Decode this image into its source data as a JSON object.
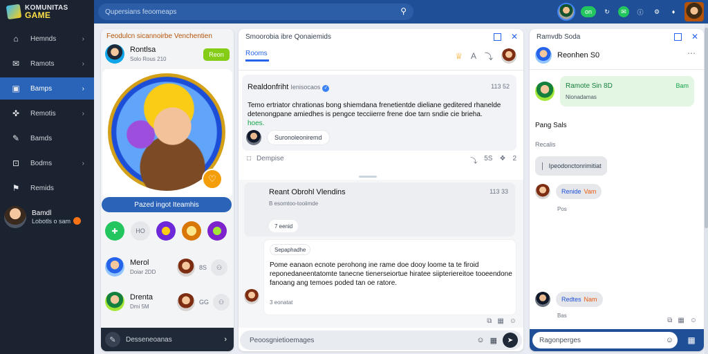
{
  "app": {
    "logo_line1": "KOMUNITAS",
    "logo_line2": "GAME"
  },
  "sidebar": {
    "items": [
      {
        "label": "Hemnds",
        "icon": "home-icon",
        "glyph": "⌂",
        "chevron": true
      },
      {
        "label": "Ramots",
        "icon": "chat-icon",
        "glyph": "✉",
        "chevron": true
      },
      {
        "label": "Bamps",
        "icon": "folder-icon",
        "glyph": "▣",
        "chevron": true,
        "active": true
      },
      {
        "label": "Remotis",
        "icon": "gamepad-icon",
        "glyph": "✜",
        "chevron": true
      },
      {
        "label": "Bamds",
        "icon": "pen-icon",
        "glyph": "✎",
        "chevron": false
      },
      {
        "label": "Bodms",
        "icon": "lock-icon",
        "glyph": "⊡",
        "chevron": true
      },
      {
        "label": "Remids",
        "icon": "flag-icon",
        "glyph": "⚑",
        "chevron": false
      }
    ],
    "user": {
      "name": "Bamdl",
      "status": "Lobotls o sam"
    }
  },
  "topbar": {
    "search_placeholder": "Qupersians feoomeaps",
    "online_label": "on",
    "icons": [
      "refresh-icon",
      "info-icon",
      "settings-icon"
    ]
  },
  "left_panel": {
    "title": "Feodulcn sicannoirbe Venchentien",
    "profile_name": "Rontlsa",
    "profile_sub": "Solo Rous 210",
    "follow_label": "Reon",
    "badge_glyph": "♡",
    "view_button": "Pazed ingot Iteamhis",
    "icon_row_counter": "HO",
    "friends": [
      {
        "name": "Merol",
        "status": "Doiar 2DD",
        "count": "8S"
      },
      {
        "name": "Drenta",
        "status": "Dmi 5M",
        "count": "GG"
      }
    ],
    "compose_placeholder": "Desseneoanas"
  },
  "middle_panel": {
    "window_title": "Smoorobia ibre Qonaiemids",
    "tab_label": "Rooms",
    "post": {
      "title": "Realdonfriht",
      "title_tail": "Ienisocaos",
      "time": "113 52",
      "body": "Temo ertriator chrationas bong shiemdana frenetientde dieliane geditered rhanelde detenongpane amiedhes is pengce tecciierre frene doe tarn sndie cie brieha.",
      "tag": "hoes.",
      "reply_pill": "Suronoleoniremd"
    },
    "post_action": "Dempise",
    "post_action_counts": [
      "5S",
      "2"
    ],
    "thread": {
      "title": "Reant Obrohl Vlendins",
      "time": "113 33",
      "sub": "B esomtoo-tooiimde",
      "pill": "7 eenid",
      "msg_tag": "Sepaphadhe",
      "msg_text": "Pome eanaon ecnote perohong ine rame doe dooy loome ta te firoid reponedaneentatomte tanecne tienerseiortue hiratee siipteriereitoe tooeendone fanoang ang temoes poded tan oe ratore.",
      "msg_foot": "3 eonatat"
    },
    "compose_placeholder": "Peoosgnietioemages"
  },
  "right_panel": {
    "window_title": "Ramvdb Soda",
    "header_name": "Reonhen S0",
    "active_card": {
      "name": "Ramote Sin",
      "count": "8D",
      "sub": "Nionadamas",
      "time": "Bam"
    },
    "section_title": "Pang Sals",
    "section_sub": "Recalis",
    "grey_pill": "Ipeodonctonrimitiat",
    "chats": [
      {
        "name": "Renide",
        "tag": "Vam",
        "time": "Pos"
      },
      {
        "name": "Redtes",
        "tag": "Nam",
        "time": "Bas"
      }
    ],
    "compose_placeholder": "Ragonperges"
  }
}
